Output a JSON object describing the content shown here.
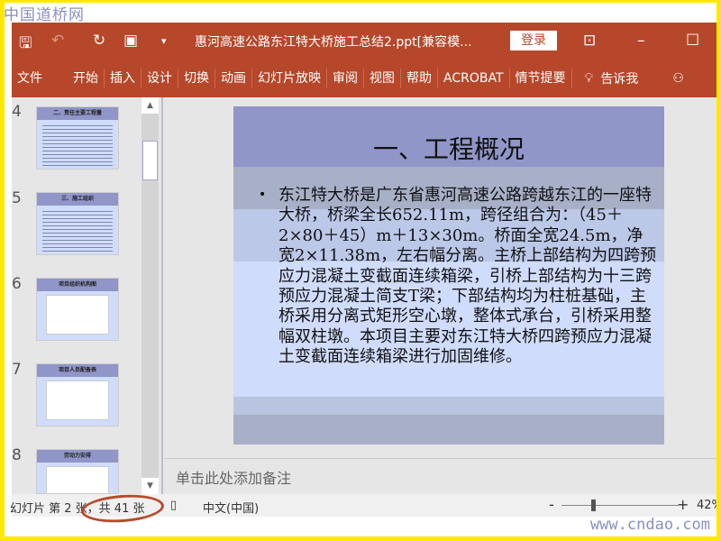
{
  "watermark_logo": "中国道桥网",
  "watermark_url": "www.cndao.com",
  "titlebar": {
    "doc_title": "惠河高速公路东江特大桥施工总结2.ppt[兼容模...",
    "login": "登录"
  },
  "ribbon": {
    "tabs": [
      "文件",
      "开始",
      "插入",
      "设计",
      "切换",
      "动画",
      "幻灯片放映",
      "审阅",
      "视图",
      "帮助",
      "ACROBAT",
      "情节提要"
    ],
    "tell_me": "告诉我"
  },
  "thumbnails": [
    {
      "num": "4",
      "title": "二、责任主要工程量"
    },
    {
      "num": "5",
      "title": "三、施工组织"
    },
    {
      "num": "6",
      "title": "项目组织机构图"
    },
    {
      "num": "7",
      "title": "项目人员配备表"
    },
    {
      "num": "8",
      "title": "劳动力安排"
    }
  ],
  "slide": {
    "title": "一、工程概况",
    "body": "东江特大桥是广东省惠河高速公路跨越东江的一座特大桥，桥梁全长652.11m，跨径组合为：（45＋2×80＋45）m＋13×30m。桥面全宽24.5m，净宽2×11.38m，左右幅分离。主桥上部结构为四跨预应力混凝土变截面连续箱梁，引桥上部结构为十三跨预应力混凝土简支T梁；下部结构均为柱桩基础，主桥采用分离式矩形空心墩，整体式承台，引桥采用整幅双柱墩。本项目主要对东江特大桥四跨预应力混凝土变截面连续箱梁进行加固维修。"
  },
  "notes_placeholder": "单击此处添加备注",
  "status": {
    "slide_info": "幻灯片 第 2 张，共 41 张",
    "language": "中文(中国)",
    "zoom": "42%"
  },
  "colors": {
    "accent": "#b7472a",
    "highlight": "#ffe800"
  }
}
